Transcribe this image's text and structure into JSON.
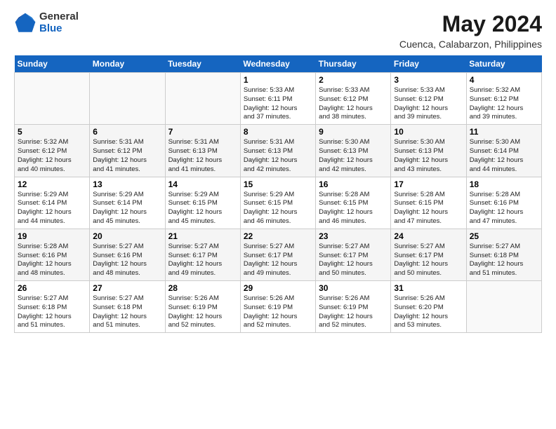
{
  "logo": {
    "general": "General",
    "blue": "Blue"
  },
  "title": "May 2024",
  "location": "Cuenca, Calabarzon, Philippines",
  "days_header": [
    "Sunday",
    "Monday",
    "Tuesday",
    "Wednesday",
    "Thursday",
    "Friday",
    "Saturday"
  ],
  "weeks": [
    [
      {
        "day": "",
        "info": ""
      },
      {
        "day": "",
        "info": ""
      },
      {
        "day": "",
        "info": ""
      },
      {
        "day": "1",
        "info": "Sunrise: 5:33 AM\nSunset: 6:11 PM\nDaylight: 12 hours\nand 37 minutes."
      },
      {
        "day": "2",
        "info": "Sunrise: 5:33 AM\nSunset: 6:12 PM\nDaylight: 12 hours\nand 38 minutes."
      },
      {
        "day": "3",
        "info": "Sunrise: 5:33 AM\nSunset: 6:12 PM\nDaylight: 12 hours\nand 39 minutes."
      },
      {
        "day": "4",
        "info": "Sunrise: 5:32 AM\nSunset: 6:12 PM\nDaylight: 12 hours\nand 39 minutes."
      }
    ],
    [
      {
        "day": "5",
        "info": "Sunrise: 5:32 AM\nSunset: 6:12 PM\nDaylight: 12 hours\nand 40 minutes."
      },
      {
        "day": "6",
        "info": "Sunrise: 5:31 AM\nSunset: 6:12 PM\nDaylight: 12 hours\nand 41 minutes."
      },
      {
        "day": "7",
        "info": "Sunrise: 5:31 AM\nSunset: 6:13 PM\nDaylight: 12 hours\nand 41 minutes."
      },
      {
        "day": "8",
        "info": "Sunrise: 5:31 AM\nSunset: 6:13 PM\nDaylight: 12 hours\nand 42 minutes."
      },
      {
        "day": "9",
        "info": "Sunrise: 5:30 AM\nSunset: 6:13 PM\nDaylight: 12 hours\nand 42 minutes."
      },
      {
        "day": "10",
        "info": "Sunrise: 5:30 AM\nSunset: 6:13 PM\nDaylight: 12 hours\nand 43 minutes."
      },
      {
        "day": "11",
        "info": "Sunrise: 5:30 AM\nSunset: 6:14 PM\nDaylight: 12 hours\nand 44 minutes."
      }
    ],
    [
      {
        "day": "12",
        "info": "Sunrise: 5:29 AM\nSunset: 6:14 PM\nDaylight: 12 hours\nand 44 minutes."
      },
      {
        "day": "13",
        "info": "Sunrise: 5:29 AM\nSunset: 6:14 PM\nDaylight: 12 hours\nand 45 minutes."
      },
      {
        "day": "14",
        "info": "Sunrise: 5:29 AM\nSunset: 6:15 PM\nDaylight: 12 hours\nand 45 minutes."
      },
      {
        "day": "15",
        "info": "Sunrise: 5:29 AM\nSunset: 6:15 PM\nDaylight: 12 hours\nand 46 minutes."
      },
      {
        "day": "16",
        "info": "Sunrise: 5:28 AM\nSunset: 6:15 PM\nDaylight: 12 hours\nand 46 minutes."
      },
      {
        "day": "17",
        "info": "Sunrise: 5:28 AM\nSunset: 6:15 PM\nDaylight: 12 hours\nand 47 minutes."
      },
      {
        "day": "18",
        "info": "Sunrise: 5:28 AM\nSunset: 6:16 PM\nDaylight: 12 hours\nand 47 minutes."
      }
    ],
    [
      {
        "day": "19",
        "info": "Sunrise: 5:28 AM\nSunset: 6:16 PM\nDaylight: 12 hours\nand 48 minutes."
      },
      {
        "day": "20",
        "info": "Sunrise: 5:27 AM\nSunset: 6:16 PM\nDaylight: 12 hours\nand 48 minutes."
      },
      {
        "day": "21",
        "info": "Sunrise: 5:27 AM\nSunset: 6:17 PM\nDaylight: 12 hours\nand 49 minutes."
      },
      {
        "day": "22",
        "info": "Sunrise: 5:27 AM\nSunset: 6:17 PM\nDaylight: 12 hours\nand 49 minutes."
      },
      {
        "day": "23",
        "info": "Sunrise: 5:27 AM\nSunset: 6:17 PM\nDaylight: 12 hours\nand 50 minutes."
      },
      {
        "day": "24",
        "info": "Sunrise: 5:27 AM\nSunset: 6:17 PM\nDaylight: 12 hours\nand 50 minutes."
      },
      {
        "day": "25",
        "info": "Sunrise: 5:27 AM\nSunset: 6:18 PM\nDaylight: 12 hours\nand 51 minutes."
      }
    ],
    [
      {
        "day": "26",
        "info": "Sunrise: 5:27 AM\nSunset: 6:18 PM\nDaylight: 12 hours\nand 51 minutes."
      },
      {
        "day": "27",
        "info": "Sunrise: 5:27 AM\nSunset: 6:18 PM\nDaylight: 12 hours\nand 51 minutes."
      },
      {
        "day": "28",
        "info": "Sunrise: 5:26 AM\nSunset: 6:19 PM\nDaylight: 12 hours\nand 52 minutes."
      },
      {
        "day": "29",
        "info": "Sunrise: 5:26 AM\nSunset: 6:19 PM\nDaylight: 12 hours\nand 52 minutes."
      },
      {
        "day": "30",
        "info": "Sunrise: 5:26 AM\nSunset: 6:19 PM\nDaylight: 12 hours\nand 52 minutes."
      },
      {
        "day": "31",
        "info": "Sunrise: 5:26 AM\nSunset: 6:20 PM\nDaylight: 12 hours\nand 53 minutes."
      },
      {
        "day": "",
        "info": ""
      }
    ]
  ]
}
